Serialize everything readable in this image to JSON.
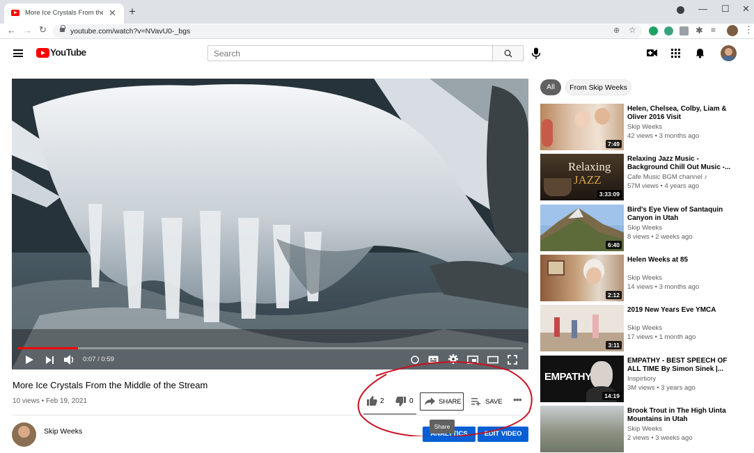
{
  "browser": {
    "tab_title": "More Ice Crystals From the Middle of the Stream",
    "url": "youtube.com/watch?v=NVavU0-_bgs"
  },
  "header": {
    "logo_text": "YouTube",
    "search_placeholder": "Search"
  },
  "player": {
    "time": "0:07 / 0:59",
    "progress": 0.12
  },
  "video": {
    "title": "More Ice Crystals From the Middle of the Stream",
    "meta": "10 views • Feb 19, 2021",
    "likes": "2",
    "dislikes": "0",
    "share_label": "SHARE",
    "save_label": "SAVE",
    "tooltip": "Share"
  },
  "channel": {
    "name": "Skip Weeks",
    "button_analytics": "ANALYTICS",
    "button_edit": "EDIT VIDEO"
  },
  "chips": {
    "all": "All",
    "from": "From Skip Weeks"
  },
  "related": [
    {
      "title": "Helen, Chelsea, Colby, Liam & Oliver 2016 Visit",
      "channel": "Skip Weeks",
      "meta": "42 views • 3 months ago",
      "duration": "7:49"
    },
    {
      "title": "Relaxing Jazz Music - Background Chill Out Music -...",
      "channel": "Cafe Music BGM channel ♪",
      "meta": "57M views • 4 years ago",
      "duration": "3:33:09",
      "thumb_text_1": "Relaxing",
      "thumb_text_2": "JAZZ"
    },
    {
      "title": "Bird's Eye View of Santaquin Canyon in Utah",
      "channel": "Skip Weeks",
      "meta": "8 views • 2 weeks ago",
      "duration": "6:40"
    },
    {
      "title": "Helen Weeks at 85",
      "channel": "Skip Weeks",
      "meta": "14 views • 3 months ago",
      "duration": "2:12"
    },
    {
      "title": "2019 New Years Eve YMCA",
      "channel": "Skip Weeks",
      "meta": "17 views • 1 month ago",
      "duration": "3:11"
    },
    {
      "title": "EMPATHY - BEST SPEECH OF ALL TIME By Simon Sinek |...",
      "channel": "Inspirtiory",
      "meta": "3M views • 3 years ago",
      "duration": "14:19",
      "thumb_text_1": "EMPATHY"
    },
    {
      "title": "Brook Trout in The High Uinta Mountains in Utah",
      "channel": "Skip Weeks",
      "meta": "2 views • 3 weeks ago",
      "duration": ""
    }
  ]
}
